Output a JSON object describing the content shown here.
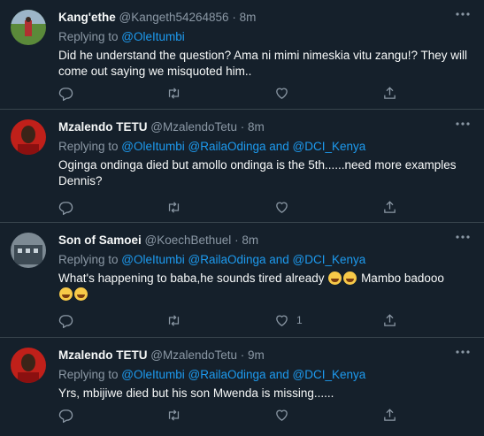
{
  "tweets": [
    {
      "name": "Kang'ethe",
      "handle": "@Kangeth54264856",
      "time": "8m",
      "replying_prefix": "Replying to ",
      "mentions": "@OleItumbi",
      "text": "Did he understand the question? Ama ni mimi nimeskia vitu zangu!? They will come out saying we misquoted him..",
      "like_count": ""
    },
    {
      "name": "Mzalendo TETU",
      "handle": "@MzalendoTetu",
      "time": "8m",
      "replying_prefix": "Replying to ",
      "mentions": "@OleItumbi @RailaOdinga and @DCI_Kenya",
      "text": "Oginga ondinga died but amollo ondinga is the 5th......need more examples Dennis?",
      "like_count": ""
    },
    {
      "name": "Son of Samoei",
      "handle": "@KoechBethuel",
      "time": "8m",
      "replying_prefix": "Replying to ",
      "mentions": "@OleItumbi @RailaOdinga and @DCI_Kenya",
      "text": "What's happening to baba,he sounds tired already",
      "text_tail": " Mambo badooo",
      "like_count": "1"
    },
    {
      "name": "Mzalendo TETU",
      "handle": "@MzalendoTetu",
      "time": "9m",
      "replying_prefix": "Replying to ",
      "mentions": "@OleItumbi @RailaOdinga and @DCI_Kenya",
      "text": "Yrs, mbijiwe died but his son Mwenda is missing......",
      "like_count": ""
    }
  ],
  "colors": {
    "background": "#15202b",
    "accent": "#1d9bf0",
    "muted": "#8b98a5",
    "divider": "#38444d"
  },
  "icons": [
    "more-icon",
    "reply-icon",
    "retweet-icon",
    "like-icon",
    "share-icon",
    "laughing-emoji-icon"
  ]
}
